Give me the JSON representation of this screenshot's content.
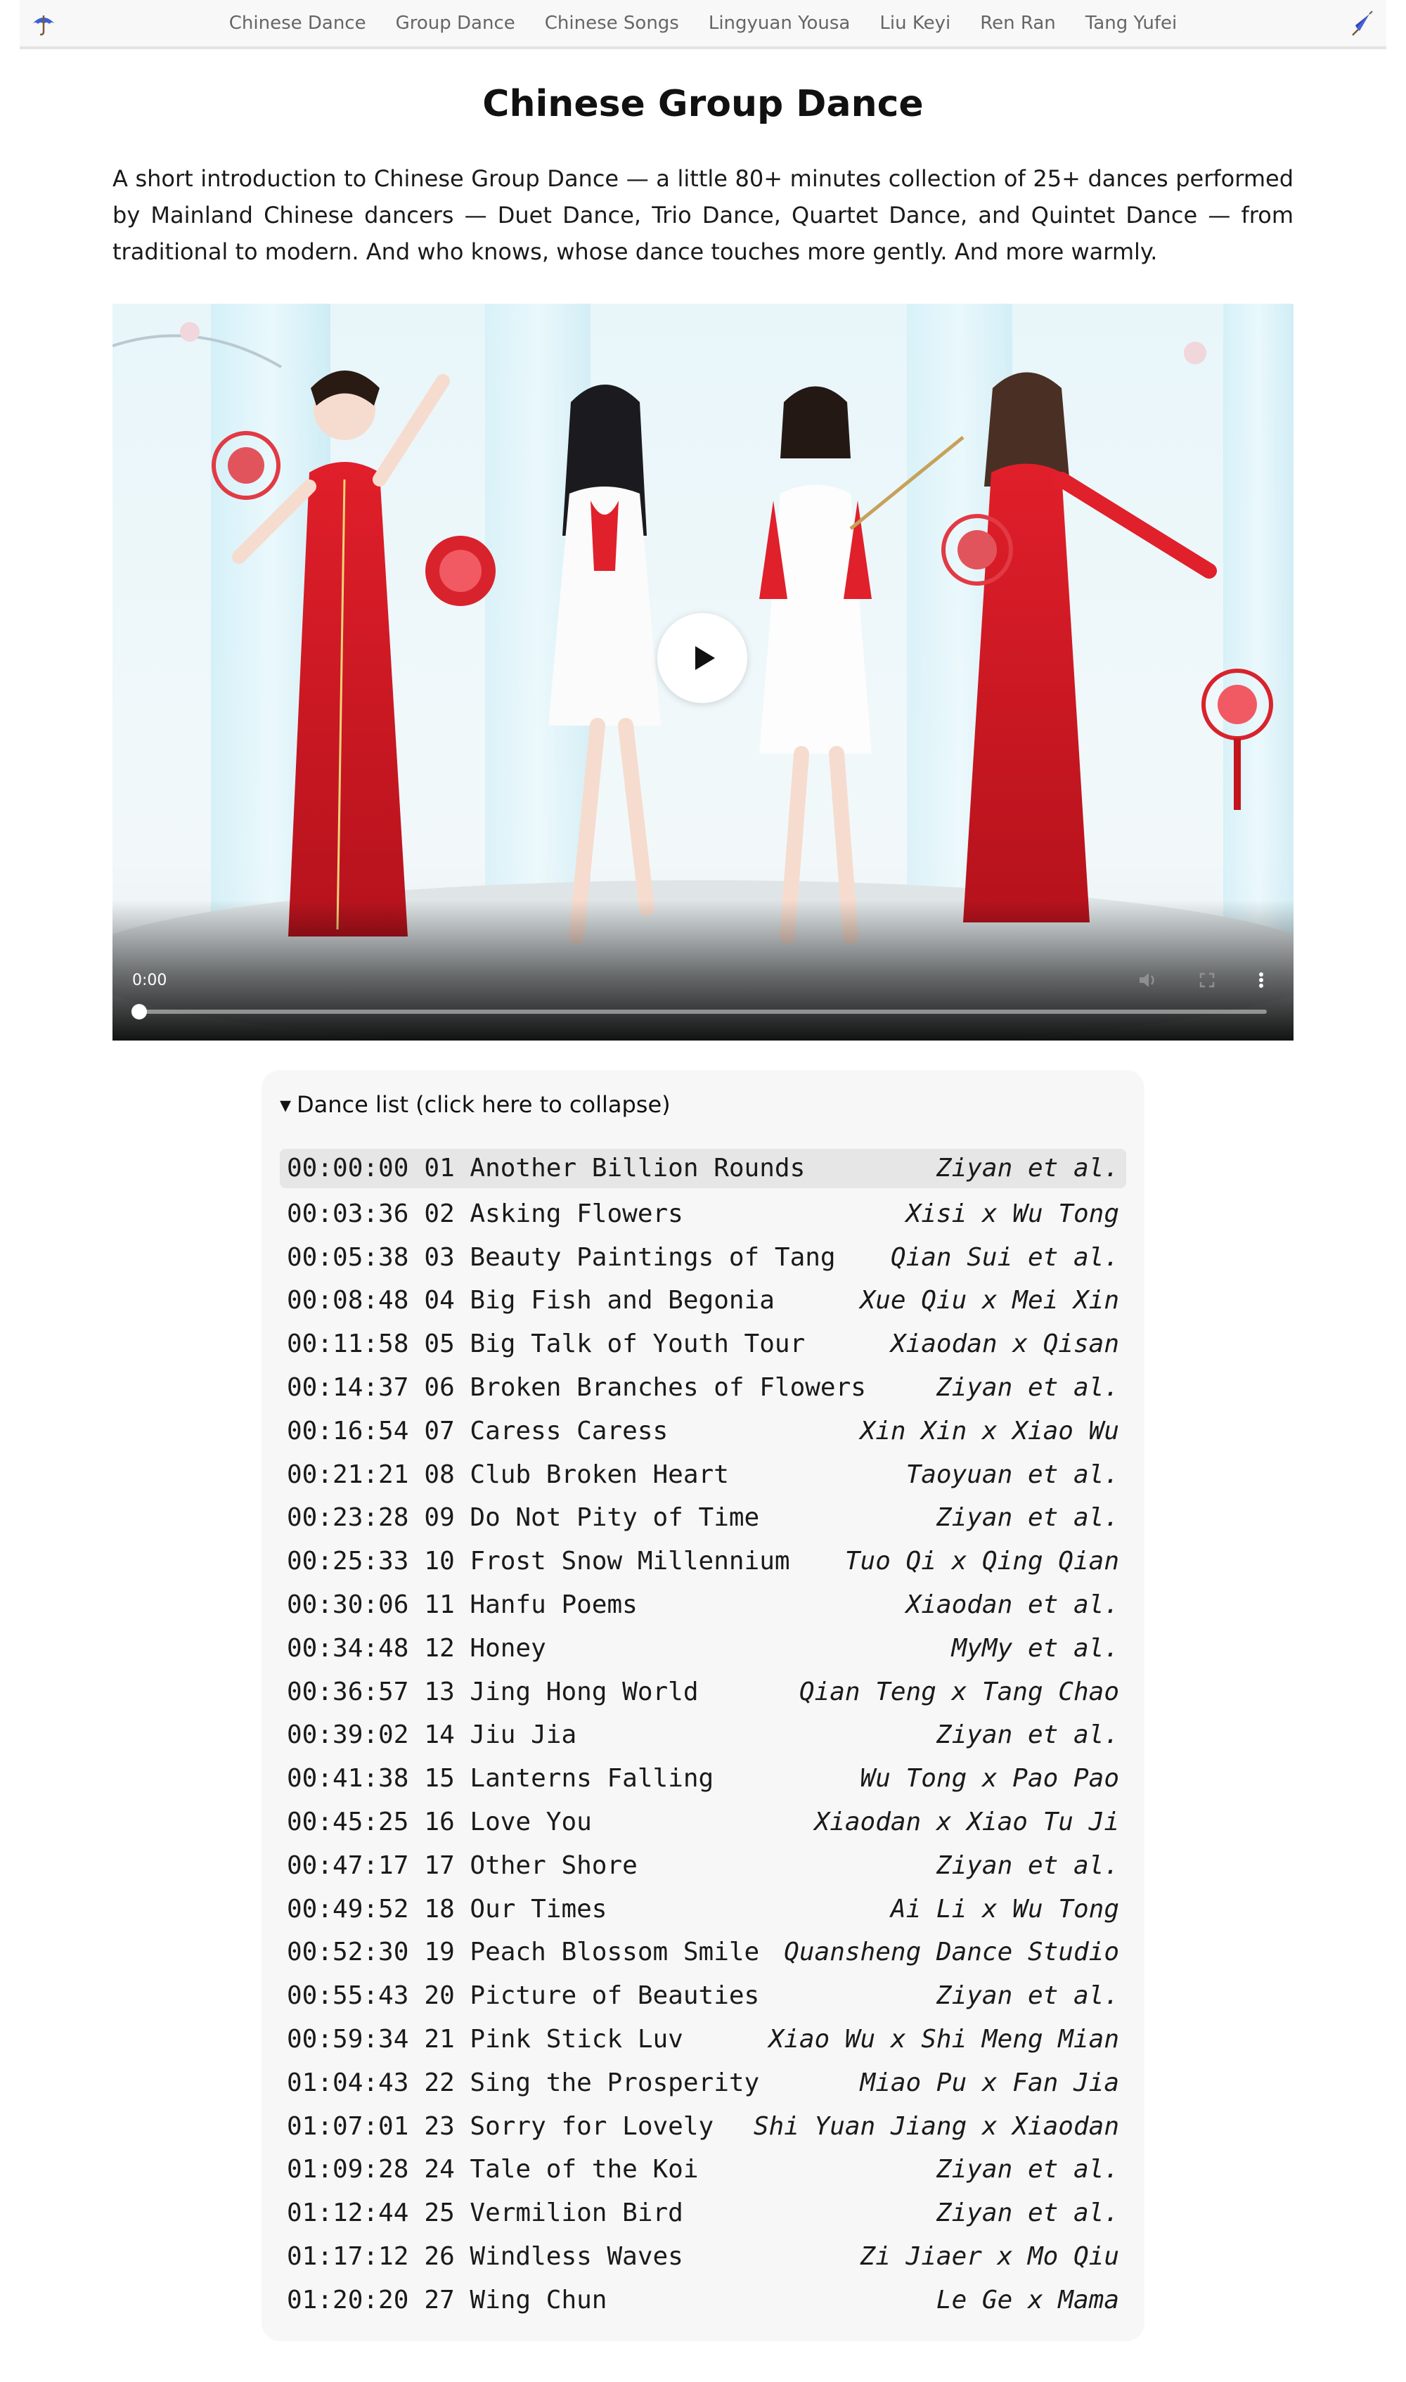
{
  "nav": {
    "left_icon": "umbrella-icon",
    "right_icon": "closed-umbrella-icon",
    "links": [
      {
        "label": "Chinese Dance"
      },
      {
        "label": "Group Dance"
      },
      {
        "label": "Chinese Songs"
      },
      {
        "label": "Lingyuan Yousa"
      },
      {
        "label": "Liu Keyi"
      },
      {
        "label": "Ren Ran"
      },
      {
        "label": "Tang Yufei"
      }
    ]
  },
  "page": {
    "title": "Chinese Group Dance",
    "intro": "A short introduction to Chinese Group Dance — a little 80+ minutes collection of 25+ dances performed by Mainland Chinese dancers — Duet Dance, Trio Dance, Quartet Dance, and Quintet Dance — from traditional to modern. And who knows, whose dance touches more gently. And more warmly."
  },
  "video": {
    "time": "0:00",
    "progress": 0,
    "controls": [
      "volume-icon",
      "fullscreen-icon",
      "more-options-icon"
    ]
  },
  "dance_list": {
    "summary": "Dance list (click here to collapse)",
    "expanded": true,
    "items": [
      {
        "time": "00:00:00",
        "title": "01 Another Billion Rounds",
        "artist": "Ziyan et al.",
        "active": true
      },
      {
        "time": "00:03:36",
        "title": "02 Asking Flowers",
        "artist": "Xisi x Wu Tong"
      },
      {
        "time": "00:05:38",
        "title": "03 Beauty Paintings of Tang",
        "artist": "Qian Sui et al."
      },
      {
        "time": "00:08:48",
        "title": "04 Big Fish and Begonia",
        "artist": "Xue Qiu x Mei Xin"
      },
      {
        "time": "00:11:58",
        "title": "05 Big Talk of Youth Tour",
        "artist": "Xiaodan x Qisan"
      },
      {
        "time": "00:14:37",
        "title": "06 Broken Branches of Flowers",
        "artist": "Ziyan et al."
      },
      {
        "time": "00:16:54",
        "title": "07 Caress Caress",
        "artist": "Xin Xin x Xiao Wu"
      },
      {
        "time": "00:21:21",
        "title": "08 Club Broken Heart",
        "artist": "Taoyuan et al."
      },
      {
        "time": "00:23:28",
        "title": "09 Do Not Pity of Time",
        "artist": "Ziyan et al."
      },
      {
        "time": "00:25:33",
        "title": "10 Frost Snow Millennium",
        "artist": "Tuo Qi x Qing Qian"
      },
      {
        "time": "00:30:06",
        "title": "11 Hanfu Poems",
        "artist": "Xiaodan et al."
      },
      {
        "time": "00:34:48",
        "title": "12 Honey",
        "artist": "MyMy et al."
      },
      {
        "time": "00:36:57",
        "title": "13 Jing Hong World",
        "artist": "Qian Teng x Tang Chao"
      },
      {
        "time": "00:39:02",
        "title": "14 Jiu Jia",
        "artist": "Ziyan et al."
      },
      {
        "time": "00:41:38",
        "title": "15 Lanterns Falling",
        "artist": "Wu Tong x Pao Pao"
      },
      {
        "time": "00:45:25",
        "title": "16 Love You",
        "artist": "Xiaodan x Xiao Tu Ji"
      },
      {
        "time": "00:47:17",
        "title": "17 Other Shore",
        "artist": "Ziyan et al."
      },
      {
        "time": "00:49:52",
        "title": "18 Our Times",
        "artist": "Ai Li x Wu Tong"
      },
      {
        "time": "00:52:30",
        "title": "19 Peach Blossom Smile",
        "artist": "Quansheng Dance Studio"
      },
      {
        "time": "00:55:43",
        "title": "20 Picture of Beauties",
        "artist": "Ziyan et al."
      },
      {
        "time": "00:59:34",
        "title": "21 Pink Stick Luv",
        "artist": "Xiao Wu x Shi Meng Mian"
      },
      {
        "time": "01:04:43",
        "title": "22 Sing the Prosperity",
        "artist": "Miao Pu x Fan Jia"
      },
      {
        "time": "01:07:01",
        "title": "23 Sorry for Lovely",
        "artist": "Shi Yuan Jiang x Xiaodan"
      },
      {
        "time": "01:09:28",
        "title": "24 Tale of the Koi",
        "artist": "Ziyan et al."
      },
      {
        "time": "01:12:44",
        "title": "25 Vermilion Bird",
        "artist": "Ziyan et al."
      },
      {
        "time": "01:17:12",
        "title": "26 Windless Waves",
        "artist": "Zi Jiaer x Mo Qiu"
      },
      {
        "time": "01:20:20",
        "title": "27 Wing Chun",
        "artist": "Le Ge x Mama"
      }
    ]
  }
}
